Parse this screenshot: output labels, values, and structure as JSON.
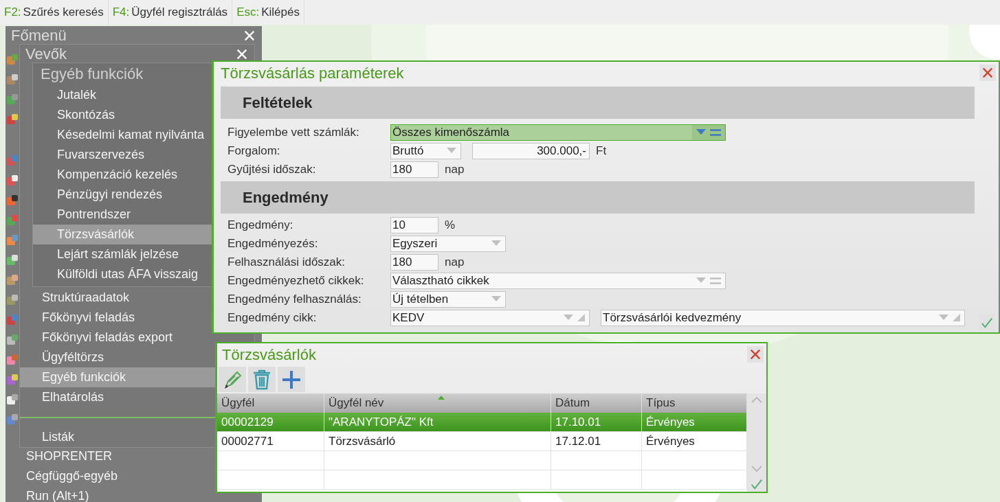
{
  "shortcut_bar": [
    {
      "key": "F2:",
      "label": "Szűrés keresés"
    },
    {
      "key": "F4:",
      "label": "Ügyfél regisztrálás"
    },
    {
      "key": "Esc:",
      "label": "Kilépés"
    }
  ],
  "main_menu": {
    "title": "Főmenü",
    "items": [
      "SHOPRENTER",
      "Cégfüggő-egyéb",
      "Run (Alt+1)"
    ]
  },
  "customers_menu": {
    "title": "Vevők",
    "items": [
      {
        "kind": "item",
        "label": "Struktúraadatok",
        "selected": false
      },
      {
        "kind": "item",
        "label": "Főkönyvi feladás",
        "selected": false
      },
      {
        "kind": "item",
        "label": "Főkönyvi feladás export",
        "selected": false
      },
      {
        "kind": "item",
        "label": "Ügyféltörzs",
        "selected": false
      },
      {
        "kind": "item",
        "label": "Egyéb funkciók",
        "selected": true
      },
      {
        "kind": "item",
        "label": "Elhatárolás",
        "selected": false
      },
      {
        "kind": "separator"
      },
      {
        "kind": "item",
        "label": "Listák",
        "selected": false
      }
    ]
  },
  "submenu": {
    "title": "Egyéb funkciók",
    "items": [
      {
        "label": "Jutalék",
        "selected": false
      },
      {
        "label": "Skontózás",
        "selected": false
      },
      {
        "label": "Késedelmi kamat nyilvánta",
        "selected": false
      },
      {
        "label": "Fuvarszervezés",
        "selected": false
      },
      {
        "label": "Kompenzáció kezelés",
        "selected": false
      },
      {
        "label": "Pénzügyi rendezés",
        "selected": false
      },
      {
        "label": "Pontrendszer",
        "selected": false
      },
      {
        "label": "Törzsvásárlók",
        "selected": true
      },
      {
        "label": "Lejárt számlák jelzése",
        "selected": false
      },
      {
        "label": "Külföldi utas ÁFA visszaig",
        "selected": false
      }
    ]
  },
  "params_dialog": {
    "title": "Törzsvásárlás paraméterek",
    "sections": [
      {
        "heading": "Feltételek",
        "rows": [
          {
            "label": "Figyelembe vett számlák:",
            "fields": [
              {
                "kind": "picker",
                "value": "Összes kimenőszámla",
                "focused": true
              }
            ]
          },
          {
            "label": "Forgalom:",
            "fields": [
              {
                "kind": "minisel",
                "value": "Bruttó"
              },
              {
                "kind": "amount",
                "value": "300.000,-"
              },
              {
                "kind": "unit",
                "value": "Ft"
              }
            ]
          },
          {
            "label": "Gyűjtési időszak:",
            "fields": [
              {
                "kind": "input",
                "value": "180"
              },
              {
                "kind": "unit",
                "value": "nap"
              }
            ]
          }
        ]
      },
      {
        "heading": "Engedmény",
        "rows": [
          {
            "label": "Engedmény:",
            "fields": [
              {
                "kind": "input",
                "value": "10"
              },
              {
                "kind": "unit",
                "value": "%"
              }
            ]
          },
          {
            "label": "Engedményezés:",
            "fields": [
              {
                "kind": "select",
                "value": "Egyszeri"
              }
            ]
          },
          {
            "label": "Felhasználási időszak:",
            "fields": [
              {
                "kind": "input",
                "value": "180"
              },
              {
                "kind": "unit",
                "value": "nap"
              }
            ]
          },
          {
            "label": "Engedményezhető cikkek:",
            "fields": [
              {
                "kind": "picker",
                "value": "Választható cikkek",
                "focused": false
              }
            ]
          },
          {
            "label": "Engedmény felhasználás:",
            "fields": [
              {
                "kind": "select",
                "value": "Új tételben"
              }
            ]
          },
          {
            "label": "Engedmény cikk:",
            "fields": [
              {
                "kind": "lookup",
                "value": "KEDV"
              },
              {
                "kind": "lookup",
                "value": "Törzsvásárlói kedvezmény"
              }
            ]
          }
        ]
      }
    ]
  },
  "customers_dialog": {
    "title": "Törzsvásárlók",
    "columns": [
      {
        "label": "Ügyfél",
        "sorted": false
      },
      {
        "label": "Ügyfél név",
        "sorted": true
      },
      {
        "label": "Dátum",
        "sorted": false
      },
      {
        "label": "Típus",
        "sorted": false
      }
    ],
    "rows": [
      {
        "cells": [
          "00002129",
          "\"ARANYTOPÁZ\" Kft",
          "17.10.01",
          "Érvényes"
        ],
        "selected": true
      },
      {
        "cells": [
          "00002771",
          "Törzsvásárló",
          "17.12.01",
          "Érvényes"
        ],
        "selected": false
      }
    ]
  }
}
